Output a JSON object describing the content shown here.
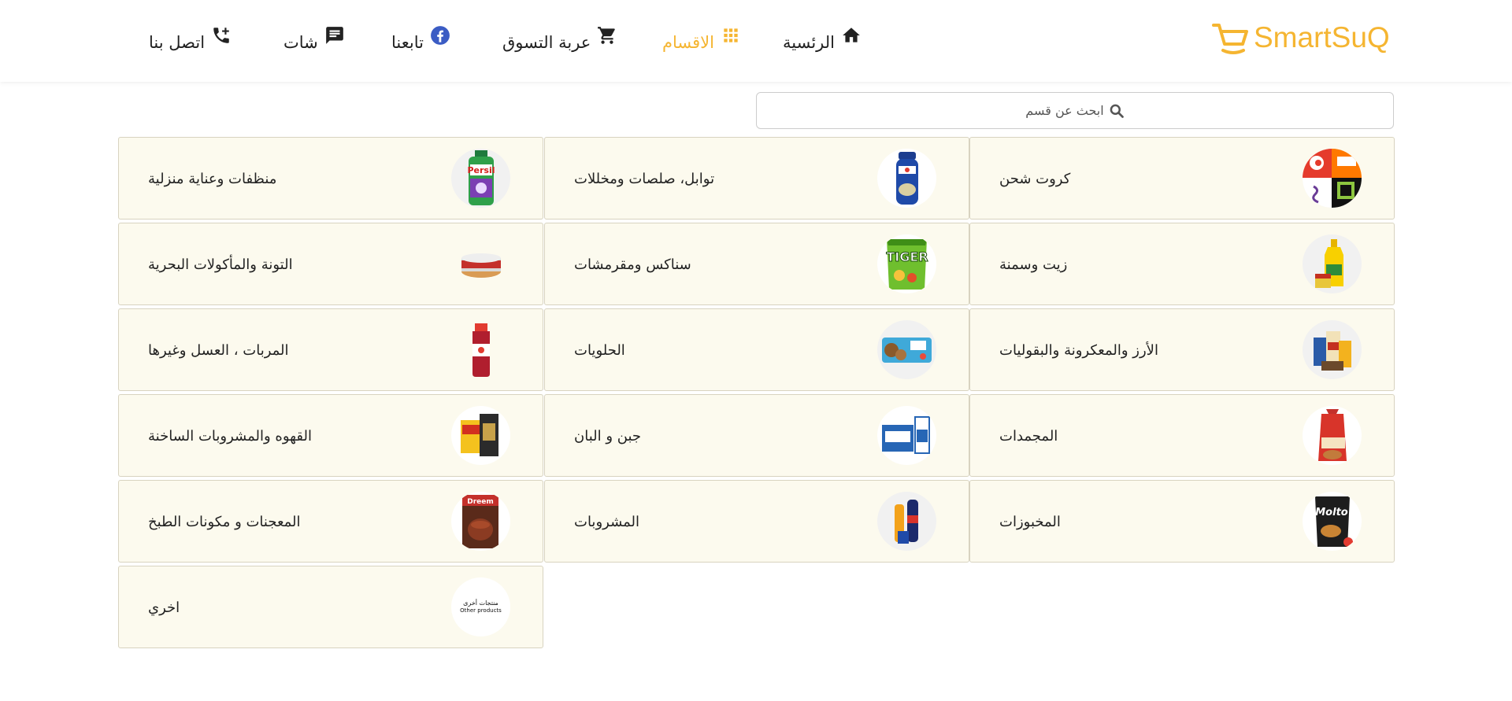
{
  "brand": {
    "name": "SmartSuQ",
    "accent": "#f5b531"
  },
  "nav": [
    {
      "key": "home",
      "label": "الرئسية",
      "icon": "home-icon"
    },
    {
      "key": "categories",
      "label": "الاقسام",
      "icon": "grid-icon",
      "active": true
    },
    {
      "key": "cart",
      "label": "عربة التسوق",
      "icon": "cart-icon"
    },
    {
      "key": "follow",
      "label": "تابعنا",
      "icon": "facebook-icon"
    },
    {
      "key": "chat",
      "label": "شات",
      "icon": "chat-icon"
    },
    {
      "key": "contact",
      "label": "اتصل بنا",
      "icon": "phone-add-icon"
    }
  ],
  "search": {
    "placeholder": "ابحث عن قسم",
    "icon": "search-icon"
  },
  "categories": [
    {
      "name": "كروت شحن",
      "icon": "recharge-cards-image"
    },
    {
      "name": "توابل، صلصات ومخللات",
      "icon": "spices-image"
    },
    {
      "name": "منظفات وعناية منزلية",
      "icon": "detergent-image"
    },
    {
      "name": "زيت وسمنة",
      "icon": "oil-image"
    },
    {
      "name": "سناكس ومقرمشات",
      "icon": "chips-image"
    },
    {
      "name": "التونة والمأكولات البحرية",
      "icon": "tuna-can-image"
    },
    {
      "name": "الأرز والمعكرونة والبقوليات",
      "icon": "rice-pasta-image"
    },
    {
      "name": "الحلويات",
      "icon": "sweets-image"
    },
    {
      "name": "المربات ، العسل وغيرها",
      "icon": "jam-jar-image"
    },
    {
      "name": "المجمدات",
      "icon": "frozen-food-image"
    },
    {
      "name": "جبن و البان",
      "icon": "dairy-image"
    },
    {
      "name": "القهوه والمشروبات الساخنة",
      "icon": "coffee-image"
    },
    {
      "name": "المخبوزات",
      "icon": "bakery-image"
    },
    {
      "name": "المشروبات",
      "icon": "drinks-image"
    },
    {
      "name": "المعجنات و مكونات الطبخ",
      "icon": "cooking-image"
    },
    {
      "name": "اخري",
      "icon": "other-products-image",
      "image_text_ar": "منتجات أخرى",
      "image_text_en": "Other products"
    }
  ]
}
